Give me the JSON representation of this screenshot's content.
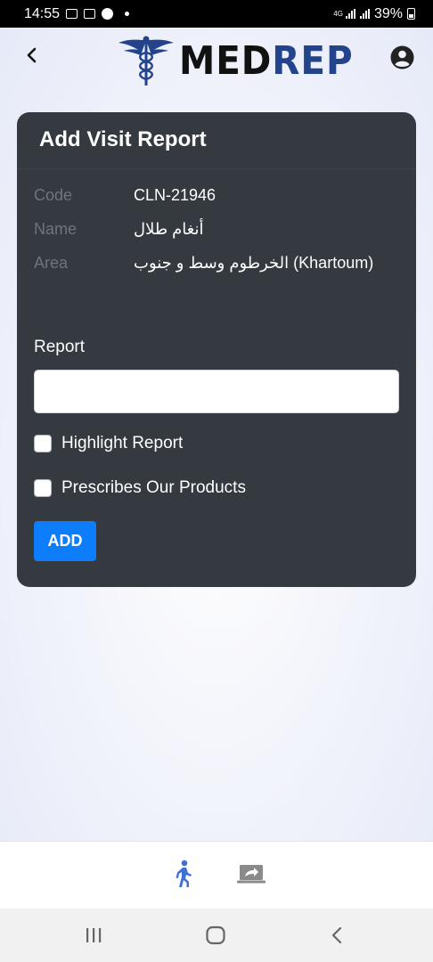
{
  "status_bar": {
    "time": "14:55",
    "network": "4G",
    "battery": "39%"
  },
  "header": {
    "logo_med": "MED",
    "logo_rep": "REP"
  },
  "card": {
    "title": "Add Visit Report",
    "fields": [
      {
        "label": "Code",
        "value": "CLN-21946"
      },
      {
        "label": "Name",
        "value": "أنغام طلال"
      },
      {
        "label": "Area",
        "value": "الخرطوم وسط و جنوب (Khartoum)"
      }
    ],
    "report_label": "Report",
    "report_value": "",
    "checkboxes": [
      {
        "label": "Highlight Report",
        "checked": false
      },
      {
        "label": "Prescribes Our Products",
        "checked": false
      }
    ],
    "add_button": "ADD"
  },
  "tabs": [
    {
      "icon": "walking-person-icon",
      "active": true
    },
    {
      "icon": "share-screen-icon",
      "active": false
    }
  ],
  "colors": {
    "card_bg": "#343a40",
    "accent": "#0d7dfc",
    "logo_blue": "#23448a",
    "active_tab": "#3c6fd8"
  }
}
